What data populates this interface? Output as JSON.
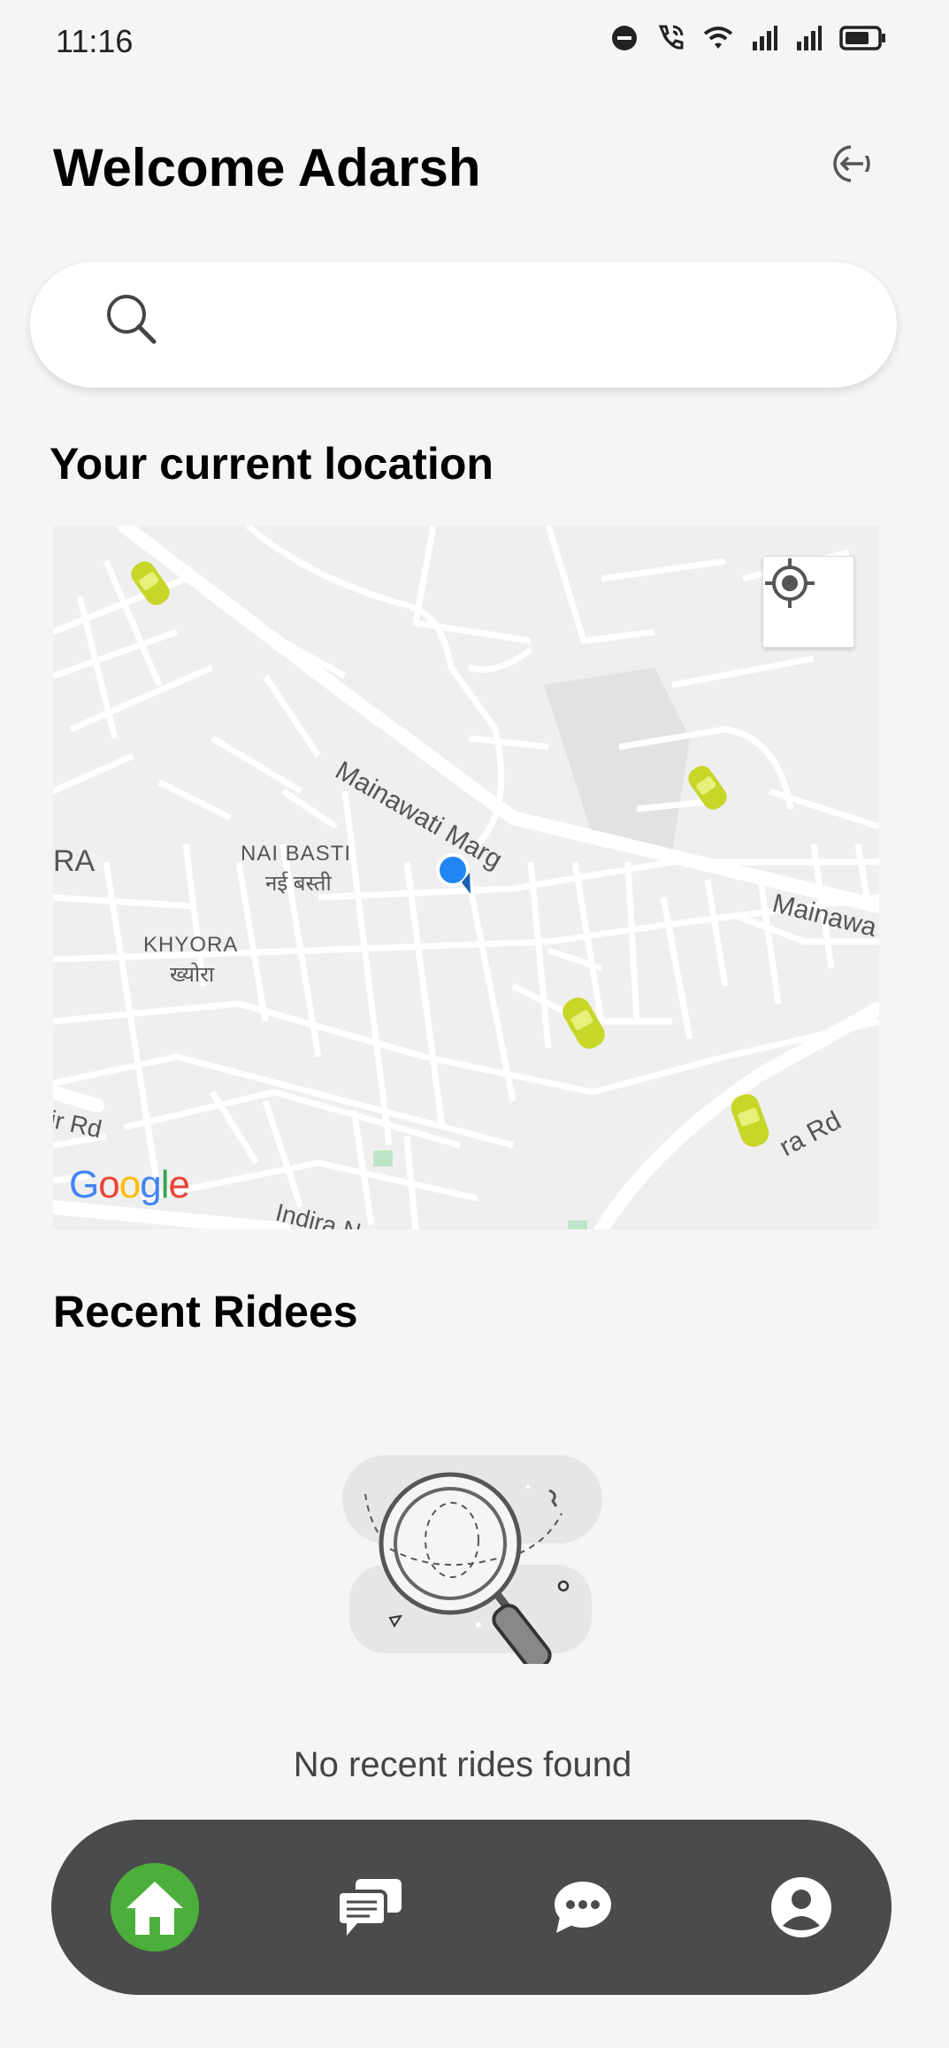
{
  "status_bar": {
    "time": "11:16",
    "icons": [
      "dnd-icon",
      "wifi-calling-icon",
      "wifi-icon",
      "signal-icon",
      "signal-icon",
      "battery-icon"
    ]
  },
  "header": {
    "title": "Welcome Adarsh",
    "logout_icon": "logout-icon"
  },
  "search": {
    "placeholder": "",
    "value": "",
    "icon": "search-icon"
  },
  "location": {
    "title": "Your current location",
    "map": {
      "labels": {
        "road_main": "Mainawati Marg",
        "road_main_right": "Mainawa",
        "area_nai_basti": "NAI BASTI",
        "area_nai_basti_hi": "नई बस्ती",
        "area_khyora": "KHYORA",
        "area_khyora_hi": "ख्योरा",
        "area_left": "RA",
        "road_left": "ir Rd",
        "road_right": "ra Rd",
        "road_bottom": "Indira N",
        "google": "Google"
      },
      "recenter_icon": "crosshair-icon",
      "colors": {
        "car": "#c8d628",
        "user_dot": "#2185f3"
      }
    }
  },
  "recent_rides": {
    "title": "Recent Ridees",
    "empty_text": "No recent rides found",
    "empty_icon": "magnifier-illustration-icon"
  },
  "bottom_nav": {
    "items": [
      {
        "icon": "home-icon",
        "active": true
      },
      {
        "icon": "messages-icon",
        "active": false
      },
      {
        "icon": "chat-bubble-icon",
        "active": false
      },
      {
        "icon": "profile-icon",
        "active": false
      }
    ],
    "colors": {
      "bar": "#4a4b4d",
      "active": "#4caf3b"
    }
  }
}
